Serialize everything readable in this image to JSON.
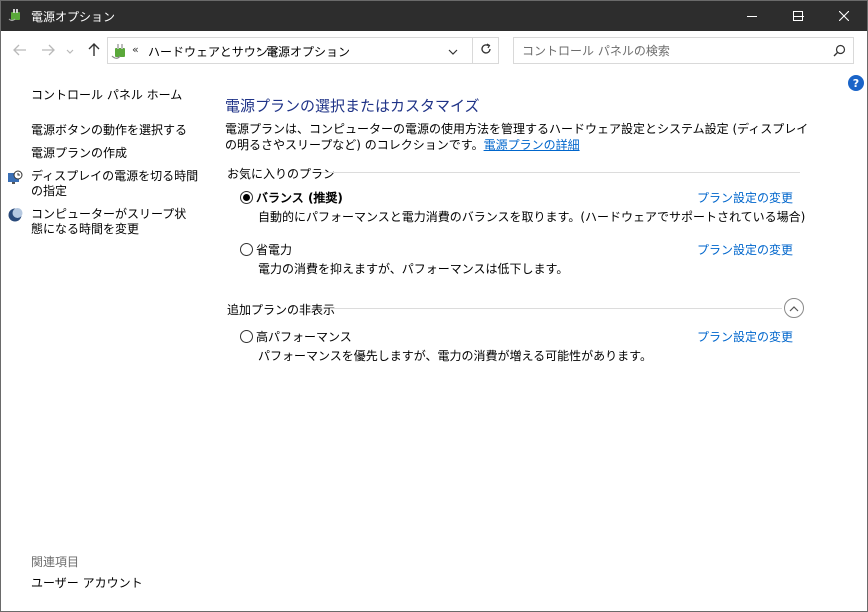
{
  "window": {
    "title": "電源オプション"
  },
  "address": {
    "overflow": "«",
    "crumb1": "ハードウェアとサウンド",
    "separator": "›",
    "crumb2": "電源オプション"
  },
  "search": {
    "placeholder": "コントロール パネルの検索"
  },
  "help": {
    "label": "?"
  },
  "sidebar": {
    "home": "コントロール パネル ホーム",
    "items": [
      "電源ボタンの動作を選択する",
      "電源プランの作成",
      "ディスプレイの電源を切る時間の指定",
      "コンピューターがスリープ状態になる時間を変更"
    ],
    "related_heading": "関連項目",
    "related_items": [
      "ユーザー アカウント"
    ]
  },
  "main": {
    "heading": "電源プランの選択またはカスタマイズ",
    "description": "電源プランは、コンピューターの電源の使用方法を管理するハードウェア設定とシステム設定 (ディスプレイの明るさやスリープなど) のコレクションです。",
    "description_link": "電源プランの詳細",
    "favorites_label": "お気に入りのプラン",
    "hidden_label": "追加プランの非表示",
    "plans": [
      {
        "name": "バランス (推奨)",
        "desc": "自動的にパフォーマンスと電力消費のバランスを取ります。(ハードウェアでサポートされている場合)",
        "link": "プラン設定の変更",
        "selected": true
      },
      {
        "name": "省電力",
        "desc": "電力の消費を抑えますが、パフォーマンスは低下します。",
        "link": "プラン設定の変更",
        "selected": false
      },
      {
        "name": "高パフォーマンス",
        "desc": "パフォーマンスを優先しますが、電力の消費が増える可能性があります。",
        "link": "プラン設定の変更",
        "selected": false
      }
    ]
  },
  "colors": {
    "titlebar": "#2d2d2d",
    "heading": "#1e3287",
    "link": "#0066cc"
  },
  "icons": [
    "power-options-icon",
    "back-arrow-icon",
    "forward-arrow-icon",
    "recent-dropdown-icon",
    "up-arrow-icon",
    "chevron-down-icon",
    "refresh-icon",
    "search-icon",
    "help-icon",
    "display-clock-icon",
    "moon-sleep-icon",
    "chevron-up-icon",
    "minimize-icon",
    "maximize-icon",
    "close-icon"
  ]
}
